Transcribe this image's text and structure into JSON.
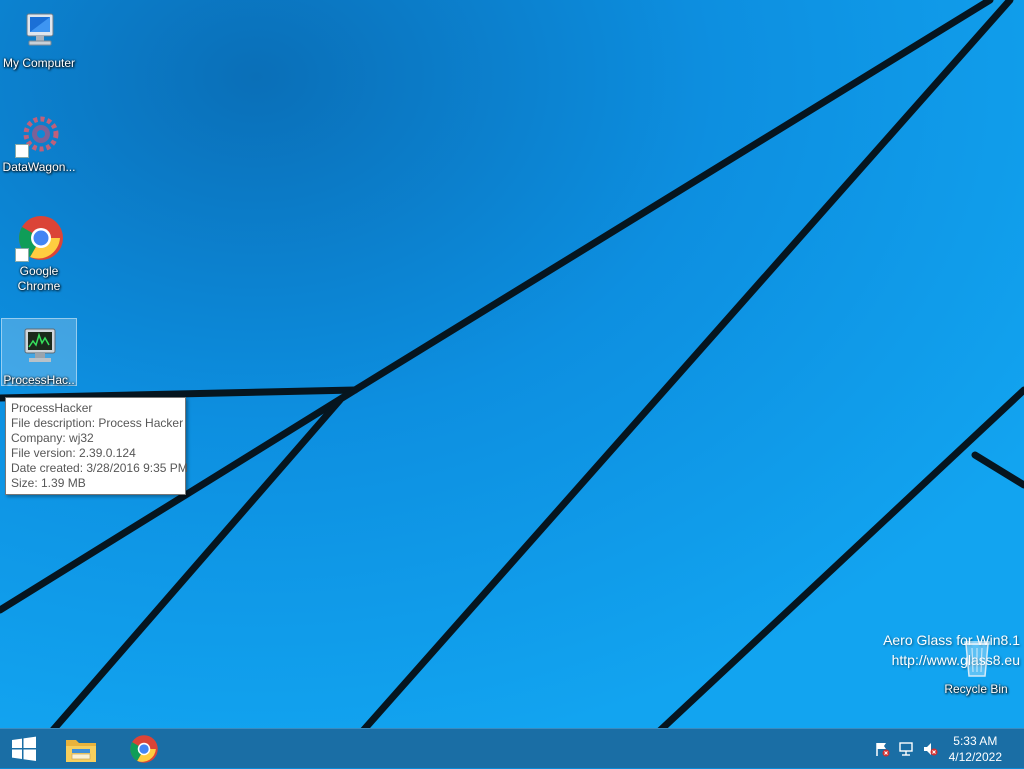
{
  "desktop": {
    "icons": [
      {
        "label": "My Computer",
        "icon": "computer-icon"
      },
      {
        "label": "DataWagon...",
        "icon": "gear-app-icon"
      },
      {
        "label": "Google Chrome",
        "icon": "chrome-icon"
      },
      {
        "label": "ProcessHac...",
        "icon": "process-hacker-icon"
      }
    ],
    "recycle_bin": {
      "label": "Recycle Bin",
      "icon": "recycle-bin-icon"
    }
  },
  "tooltip": {
    "title": "ProcessHacker",
    "description": "File description: Process Hacker",
    "company": "Company: wj32",
    "version": "File version: 2.39.0.124",
    "created": "Date created: 3/28/2016 9:35 PM",
    "size": "Size: 1.39 MB"
  },
  "watermark": {
    "line1": "Aero Glass for Win8.1",
    "line2": "http://www.glass8.eu"
  },
  "taskbar": {
    "start_icon": "windows-logo-icon",
    "pinned": [
      {
        "name": "file-explorer",
        "icon": "folder-icon"
      },
      {
        "name": "chrome",
        "icon": "chrome-icon"
      }
    ],
    "tray": [
      "action-center-flag-icon",
      "network-icon",
      "volume-muted-icon"
    ],
    "clock": {
      "time": "5:33 AM",
      "date": "4/12/2022"
    }
  },
  "colors": {
    "wallpaper": "#0b8ad6",
    "taskbar": "#1a6ea5"
  }
}
